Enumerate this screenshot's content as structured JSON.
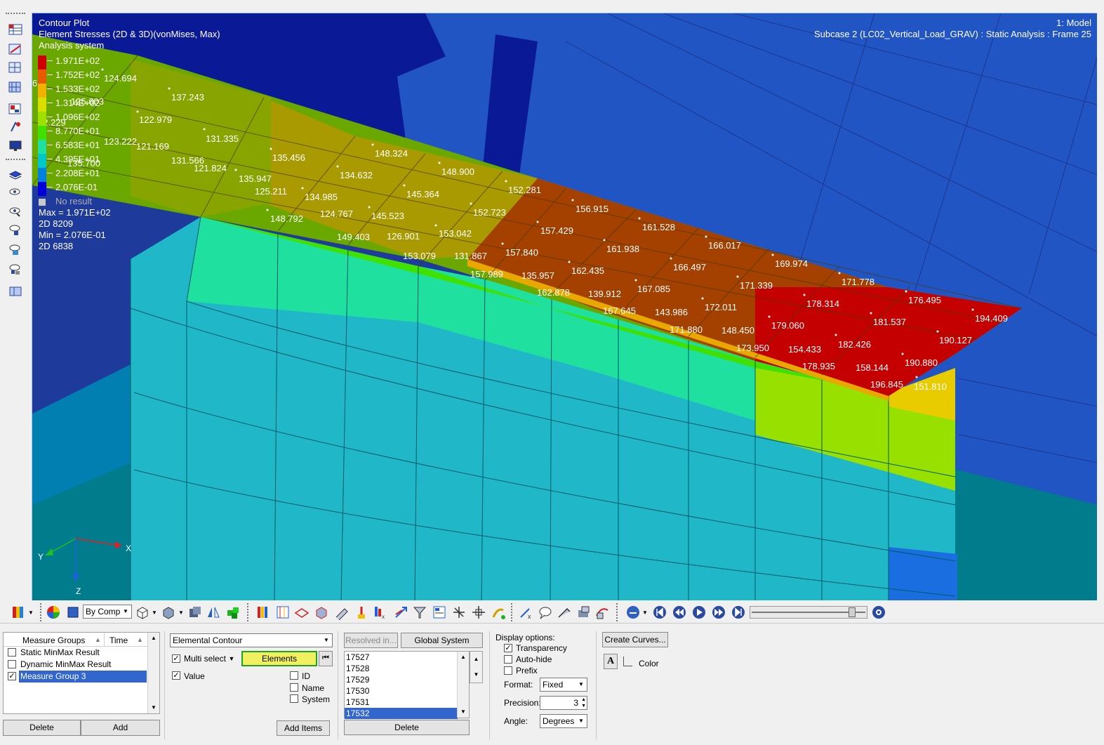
{
  "viewport": {
    "plot_title": "Contour Plot",
    "result_type": "Element Stresses (2D & 3D)(vonMises, Max)",
    "system": "Analysis system",
    "model_label": "1: Model",
    "subcase_label": "Subcase 2 (LC02_Vertical_Load_GRAV) : Static Analysis : Frame 25"
  },
  "legend": {
    "levels": [
      "1.971E+02",
      "1.752E+02",
      "1.533E+02",
      "1.314E+02",
      "1.096E+02",
      "8.770E+01",
      "6.583E+01",
      "4.395E+01",
      "2.208E+01",
      "2.076E-01"
    ],
    "colors": [
      "#d00000",
      "#e85a00",
      "#f0b400",
      "#d8e000",
      "#a0e000",
      "#40e000",
      "#20e0a0",
      "#00c8c8",
      "#0080e0",
      "#0000d8"
    ],
    "no_result_label": "No result",
    "no_result_color": "#c8c8c8",
    "max_line": "Max = 1.971E+02",
    "max_elem": "2D 8209",
    "min_line": "Min = 2.076E-01",
    "min_elem": "2D 6838"
  },
  "axes": {
    "x": "X",
    "y": "Y",
    "z": "Z"
  },
  "element_values": [
    "124.694",
    "137.243",
    "122.979",
    "131.335",
    "123.222",
    "121.169",
    "135.456",
    "148.324",
    "131.566",
    "121.824",
    "134.632",
    "148.900",
    "135.947",
    "125.211",
    "145.364",
    "152.281",
    "134.985",
    "124.767",
    "152.723",
    "156.915",
    "148.792",
    "145.523",
    "149.403",
    "126.901",
    "153.042",
    "157.429",
    "161.528",
    "153.079",
    "131.867",
    "157.840",
    "161.938",
    "166.017",
    "157.989",
    "135.957",
    "162.435",
    "166.497",
    "169.974",
    "162.878",
    "139.912",
    "167.085",
    "171.339",
    "171.778",
    "167.645",
    "143.986",
    "172.011",
    "178.314",
    "176.495",
    "171.880",
    "148.450",
    "179.060",
    "181.537",
    "194.409",
    "173.950",
    "154.433",
    "182.426",
    "190.127",
    "178.935",
    "158.144",
    "190.880",
    "196.845",
    "151.810",
    "135.700",
    "42.229",
    "125.603",
    "6"
  ],
  "toolbar": {
    "by_comp": "By Comp"
  },
  "measure_groups": {
    "col_name": "Measure Groups",
    "col_time": "Time",
    "items": [
      "Static MinMax Result",
      "Dynamic MinMax Result",
      "Measure Group 3"
    ],
    "checked": [
      false,
      false,
      true
    ],
    "delete": "Delete",
    "add": "Add"
  },
  "measure_type": {
    "value": "Elemental Contour",
    "multi_select": "Multi select",
    "entity": "Elements",
    "value_label": "Value",
    "id_label": "ID",
    "name_label": "Name",
    "system_label": "System",
    "add_items": "Add Items"
  },
  "system_select": {
    "resolved": "Resolved in...",
    "global": "Global System",
    "ids": [
      "17527",
      "17528",
      "17529",
      "17530",
      "17531",
      "17532"
    ],
    "delete": "Delete"
  },
  "display_options": {
    "title": "Display options:",
    "transparency": "Transparency",
    "auto_hide": "Auto-hide",
    "prefix": "Prefix",
    "format_label": "Format:",
    "format_value": "Fixed",
    "precision_label": "Precision:",
    "precision_value": "3",
    "angle_label": "Angle:",
    "angle_value": "Degrees"
  },
  "curves": {
    "create": "Create Curves...",
    "font_glyph": "A",
    "color_label": "Color"
  }
}
